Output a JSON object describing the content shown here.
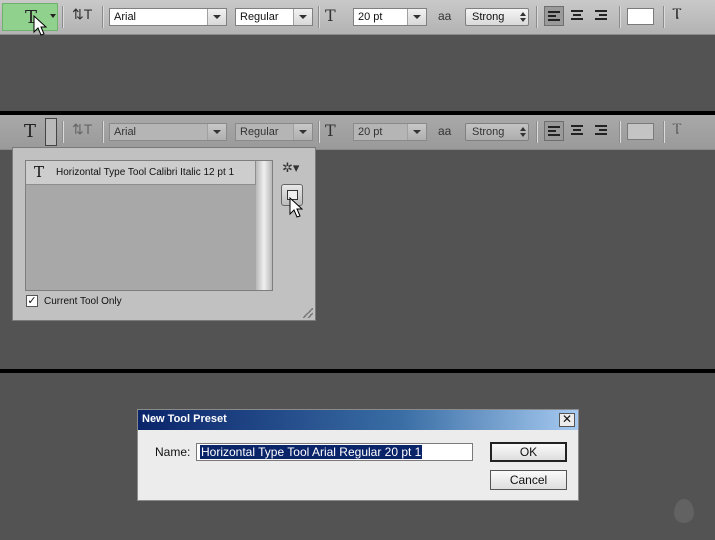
{
  "toolbar": {
    "font_family": "Arial",
    "font_style": "Regular",
    "font_size": "20 pt",
    "antialias": "Strong"
  },
  "preset_picker": {
    "items": [
      {
        "label": "Horizontal Type Tool Calibri Italic 12 pt 1"
      }
    ],
    "current_tool_only_label": "Current Tool Only",
    "current_tool_only_checked": true
  },
  "dialog": {
    "title": "New Tool Preset",
    "name_label": "Name:",
    "name_value": "Horizontal Type  Tool Arial Regular 20 pt 1",
    "ok_label": "OK",
    "cancel_label": "Cancel",
    "close_glyph": "✕"
  },
  "icons": {
    "type_tool": "T",
    "type_size": "T",
    "antialias": "aa",
    "check": "✓",
    "gear": "✲▾"
  }
}
